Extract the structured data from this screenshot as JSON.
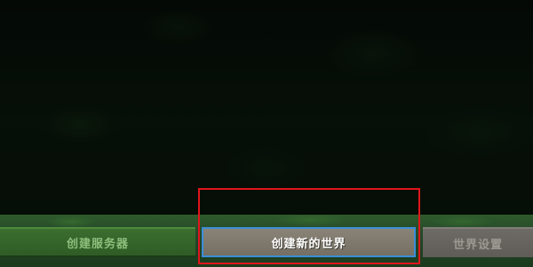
{
  "screen": {
    "background_theme": "dark-forest"
  },
  "buttons": {
    "create_server": {
      "label": "创建服务器",
      "state": "normal"
    },
    "create_world": {
      "label": "创建新的世界",
      "state": "selected"
    },
    "world_settings": {
      "label": "世界设置",
      "state": "disabled"
    }
  },
  "colors": {
    "selection_border": "#3a8ed8",
    "highlight_frame": "#e0151b",
    "green_button": "#2f5c25",
    "gray_button": "#756f63"
  }
}
